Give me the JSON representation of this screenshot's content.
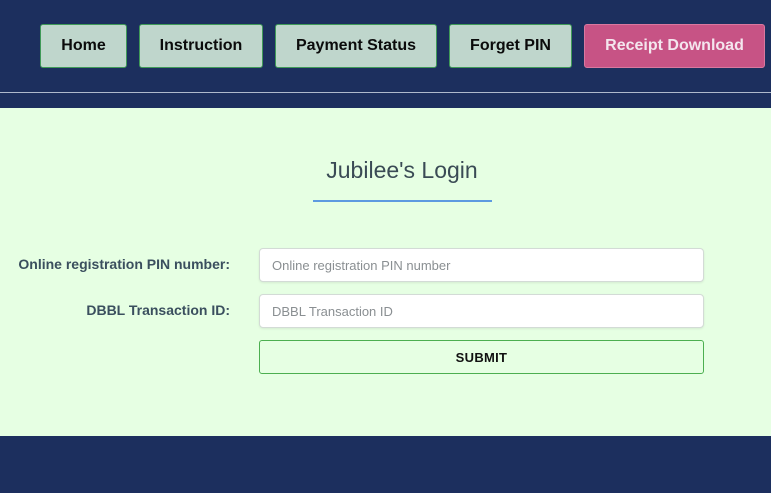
{
  "nav": {
    "items": [
      {
        "label": "Home"
      },
      {
        "label": "Instruction"
      },
      {
        "label": "Payment Status"
      },
      {
        "label": "Forget PIN"
      },
      {
        "label": "Receipt Download"
      }
    ]
  },
  "login": {
    "title": "Jubilee's Login",
    "pin": {
      "label": "Online registration PIN number:",
      "placeholder": "Online registration PIN number",
      "value": ""
    },
    "transaction": {
      "label": "DBBL Transaction ID:",
      "placeholder": "DBBL Transaction ID",
      "value": ""
    },
    "submit_label": "SUBMIT"
  },
  "colors": {
    "header_bg": "#1c2f5e",
    "nav_button_bg": "#bfd6cc",
    "nav_active_bg": "#c75385",
    "panel_bg": "#e6ffe3",
    "accent_underline": "#5d9ae0",
    "submit_border": "#4caf50"
  }
}
